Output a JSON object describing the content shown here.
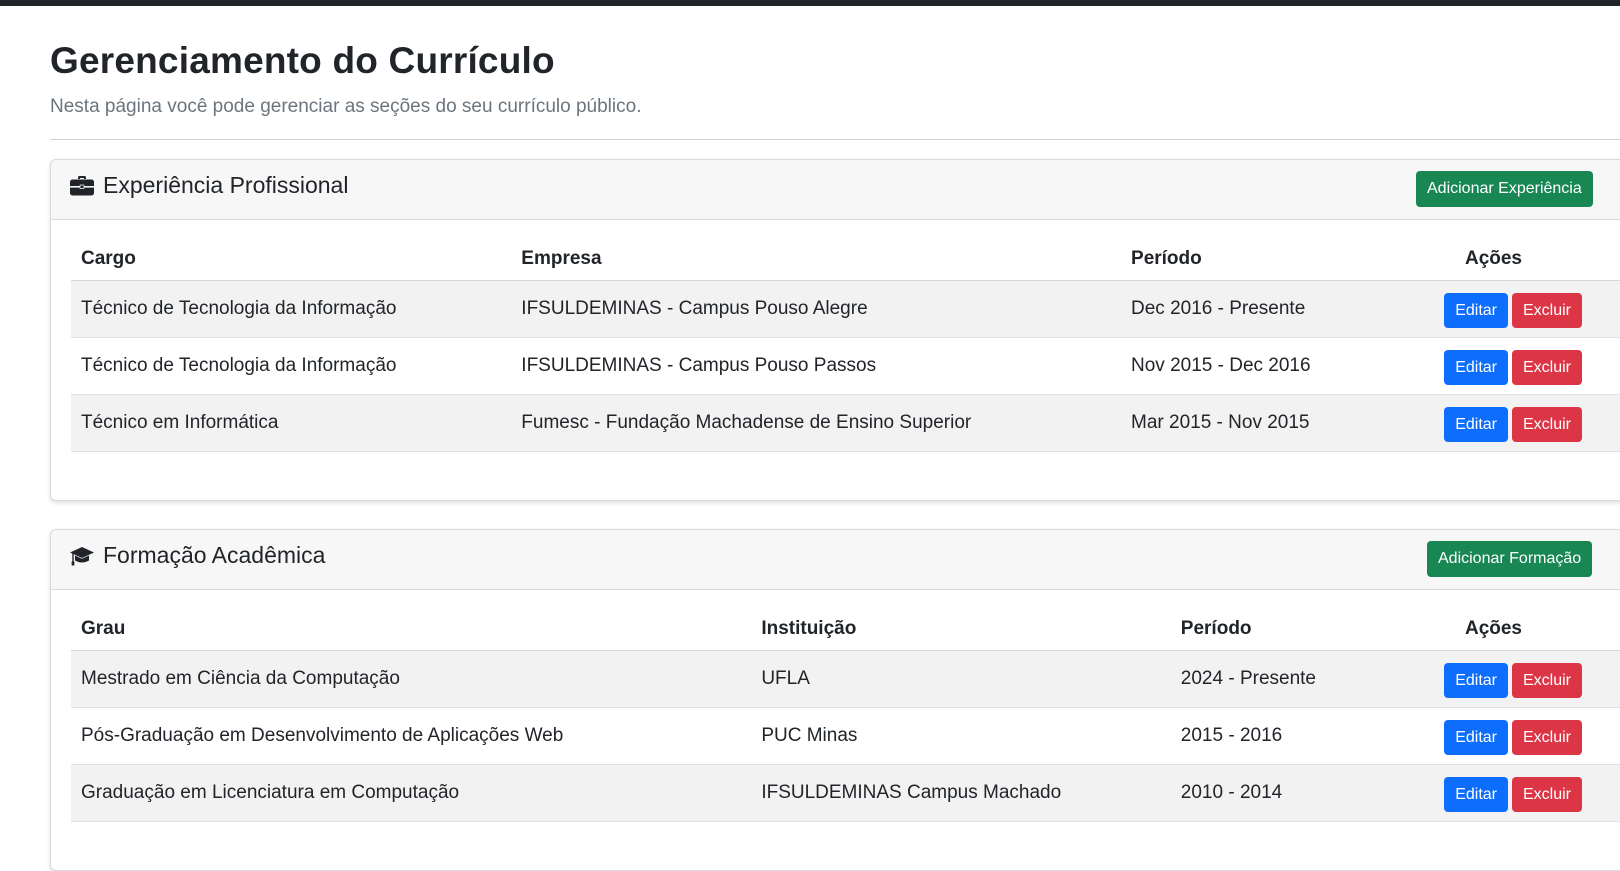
{
  "page": {
    "title": "Gerenciamento do Currículo",
    "subtitle": "Nesta página você pode gerenciar as seções do seu currículo público."
  },
  "experience": {
    "title": "Experiência Profissional",
    "icon": "briefcase-icon",
    "add_label": "Adicionar Experiência",
    "columns": [
      "Cargo",
      "Empresa",
      "Período",
      "Ações"
    ],
    "rows": [
      {
        "cargo": "Técnico de Tecnologia da Informação",
        "empresa": "IFSULDEMINAS - Campus Pouso Alegre",
        "periodo": "Dec 2016 - Presente"
      },
      {
        "cargo": "Técnico de Tecnologia da Informação",
        "empresa": "IFSULDEMINAS - Campus Pouso Passos",
        "periodo": "Nov 2015 - Dec 2016"
      },
      {
        "cargo": "Técnico em Informática",
        "empresa": "Fumesc - Fundação Machadense de Ensino Superior",
        "periodo": "Mar 2015 - Nov 2015"
      }
    ]
  },
  "education": {
    "title": "Formação Acadêmica",
    "icon": "graduation-cap-icon",
    "add_label": "Adicionar Formação",
    "columns": [
      "Grau",
      "Instituição",
      "Período",
      "Ações"
    ],
    "rows": [
      {
        "grau": "Mestrado em Ciência da Computação",
        "instituicao": "UFLA",
        "periodo": "2024 - Presente"
      },
      {
        "grau": "Pós-Graduação em Desenvolvimento de Aplicações Web",
        "instituicao": "PUC Minas",
        "periodo": "2015 - 2016"
      },
      {
        "grau": "Graduação em Licenciatura em Computação",
        "instituicao": "IFSULDEMINAS Campus Machado",
        "periodo": "2010 - 2014"
      }
    ]
  },
  "actions": {
    "edit_label": "Editar",
    "delete_label": "Excluir"
  },
  "colors": {
    "primary": "#0d6efd",
    "danger": "#dc3545",
    "success": "#198754",
    "topbar": "#212529"
  }
}
